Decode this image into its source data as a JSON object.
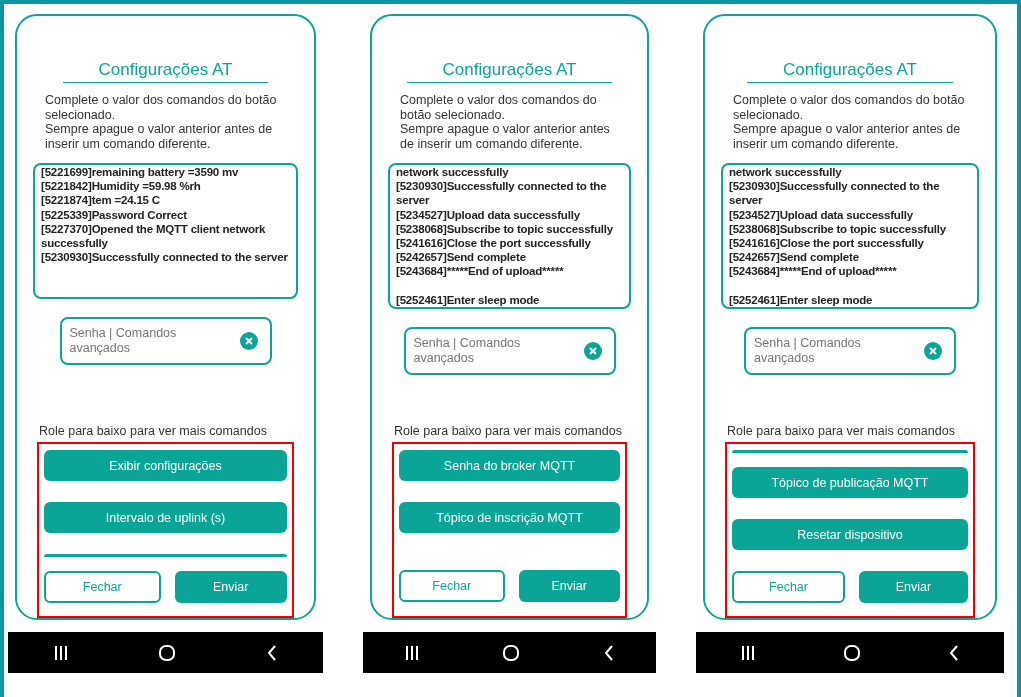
{
  "panels": [
    {
      "title": "Configurações AT",
      "instructions": [
        "Complete o valor dos comandos do botão selecionado.",
        "Sempre apague o valor anterior antes de inserir um comando diferente."
      ],
      "log": [
        "[5221699]remaining battery =3590 mv",
        "[5221842]Humidity =59.98 %rh",
        "[5221874]tem =24.15 C",
        "[5225339]Password Correct",
        "[5227370]Opened the MQTT client network successfully",
        "[5230930]Successfully connected to the server"
      ],
      "field": {
        "placeholder": "Senha | Comandos avançados"
      },
      "scroll_hint": "Role para baixo para ver mais comandos",
      "highlighted": true,
      "commands": [
        {
          "kind": "button",
          "label": "Exibir configurações"
        },
        {
          "kind": "button",
          "label": "Intervalo de uplink (s)"
        },
        {
          "kind": "partial"
        }
      ],
      "buttons": [
        {
          "kind": "outline",
          "label": "Fechar"
        },
        {
          "kind": "filled",
          "label": "Enviar"
        }
      ]
    },
    {
      "title": "Configurações AT",
      "instructions": [
        "Complete o valor dos comandos do botão selecionado.",
        "Sempre apague o valor anterior antes de inserir um comando diferente."
      ],
      "log": [
        "network successfully",
        "[5230930]Successfully connected to the server",
        "[5234527]Upload data successfully",
        "[5238068]Subscribe to topic successfully",
        "[5241616]Close the port successfully",
        "[5242657]Send complete",
        "[5243684]*****End of upload*****",
        "[5252461]Enter sleep mode"
      ],
      "field": {
        "placeholder": "Senha | Comandos avançados"
      },
      "scroll_hint": "Role para baixo para ver mais comandos",
      "highlighted": true,
      "commands": [
        {
          "kind": "button",
          "label": "Senha do broker MQTT"
        },
        {
          "kind": "button",
          "label": "Tópico de inscrição MQTT"
        }
      ],
      "buttons": [
        {
          "kind": "outline",
          "label": "Fechar"
        },
        {
          "kind": "filled",
          "label": "Enviar"
        }
      ]
    },
    {
      "title": "Configurações AT",
      "instructions": [
        "Complete o valor dos comandos do botão selecionado.",
        "Sempre apague o valor anterior antes de inserir um comando diferente."
      ],
      "log": [
        "network successfully",
        "[5230930]Successfully connected to the server",
        "[5234527]Upload data successfully",
        "[5238068]Subscribe to topic successfully",
        "[5241616]Close the port successfully",
        "[5242657]Send complete",
        "[5243684]*****End of upload*****",
        "[5252461]Enter sleep mode"
      ],
      "field": {
        "placeholder": "Senha | Comandos avançados"
      },
      "scroll_hint": "Role para baixo para ver mais comandos",
      "highlighted": true,
      "commands": [
        {
          "kind": "partial"
        },
        {
          "kind": "button",
          "label": "Tópico de publicação MQTT"
        },
        {
          "kind": "button",
          "label": "Resetar dispositivo"
        }
      ],
      "buttons": [
        {
          "kind": "outline",
          "label": "Fechar"
        },
        {
          "kind": "filled",
          "label": "Enviar"
        }
      ]
    }
  ]
}
